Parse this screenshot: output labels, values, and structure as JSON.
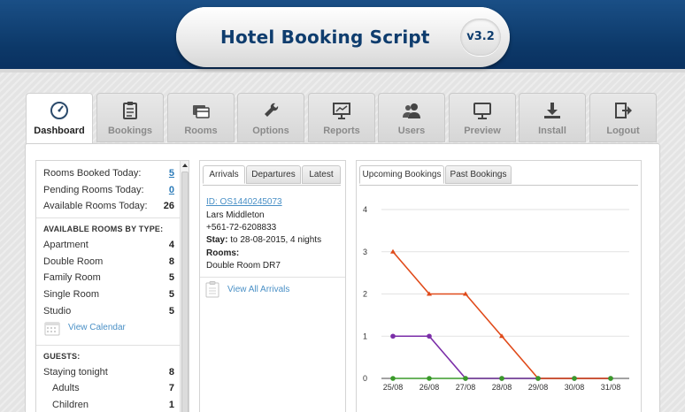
{
  "header": {
    "title": "Hotel Booking Script",
    "version": "v3.2"
  },
  "tabs": [
    {
      "label": "Dashboard",
      "icon": "gauge-icon",
      "active": true
    },
    {
      "label": "Bookings",
      "icon": "clipboard-icon",
      "active": false
    },
    {
      "label": "Rooms",
      "icon": "cards-icon",
      "active": false
    },
    {
      "label": "Options",
      "icon": "wrench-icon",
      "active": false
    },
    {
      "label": "Reports",
      "icon": "presentation-icon",
      "active": false
    },
    {
      "label": "Users",
      "icon": "users-icon",
      "active": false
    },
    {
      "label": "Preview",
      "icon": "monitor-icon",
      "active": false
    },
    {
      "label": "Install",
      "icon": "download-icon",
      "active": false
    },
    {
      "label": "Logout",
      "icon": "logout-icon",
      "active": false
    }
  ],
  "summary": {
    "rooms_booked_today": {
      "label": "Rooms Booked Today:",
      "value": "5"
    },
    "pending_rooms_today": {
      "label": "Pending Rooms Today:",
      "value": "0"
    },
    "available_rooms_today": {
      "label": "Available Rooms Today:",
      "value": "26"
    }
  },
  "available_by_type": {
    "heading": "AVAILABLE ROOMS BY TYPE:",
    "items": [
      {
        "label": "Apartment",
        "value": "4"
      },
      {
        "label": "Double Room",
        "value": "8"
      },
      {
        "label": "Family Room",
        "value": "5"
      },
      {
        "label": "Single Room",
        "value": "5"
      },
      {
        "label": "Studio",
        "value": "5"
      }
    ],
    "calendar_link": "View Calendar"
  },
  "guests": {
    "heading": "GUESTS:",
    "staying_tonight": {
      "label": "Staying tonight",
      "value": "8"
    },
    "adults": {
      "label": "Adults",
      "value": "7"
    },
    "children": {
      "label": "Children",
      "value": "1"
    }
  },
  "middle": {
    "tabs": [
      "Arrivals",
      "Departures",
      "Latest"
    ],
    "active_tab": "Arrivals",
    "arrival": {
      "id": "ID: OS1440245073",
      "name": "Lars Middleton",
      "phone": "+561-72-6208833",
      "stay_label": "Stay:",
      "stay_value": "to 28-08-2015, 4 nights",
      "rooms_label": "Rooms:",
      "rooms_value": "Double Room DR7"
    },
    "view_all_link": "View All Arrivals"
  },
  "right": {
    "tabs": [
      "Upcoming Bookings",
      "Past Bookings"
    ],
    "active_tab": "Upcoming Bookings"
  },
  "colors": {
    "header_blue": "#0c3868",
    "link_blue": "#4a90c6",
    "series_red": "#e04a1a",
    "series_purple": "#7b2ea8",
    "series_green": "#3a9a2a"
  },
  "chart_data": {
    "type": "line",
    "categories": [
      "25/08",
      "26/08",
      "27/08",
      "28/08",
      "29/08",
      "30/08",
      "31/08"
    ],
    "ylim": [
      0,
      4
    ],
    "yticks": [
      0,
      1,
      2,
      3,
      4
    ],
    "grid": true,
    "series": [
      {
        "color": "#e04a1a",
        "values": [
          3,
          2,
          2,
          1,
          0,
          0,
          0
        ]
      },
      {
        "color": "#7b2ea8",
        "values": [
          1,
          1,
          0,
          0,
          0,
          0,
          0
        ]
      },
      {
        "color": "#3a9a2a",
        "values": [
          0,
          0,
          0,
          0,
          0,
          0,
          0
        ]
      }
    ]
  }
}
